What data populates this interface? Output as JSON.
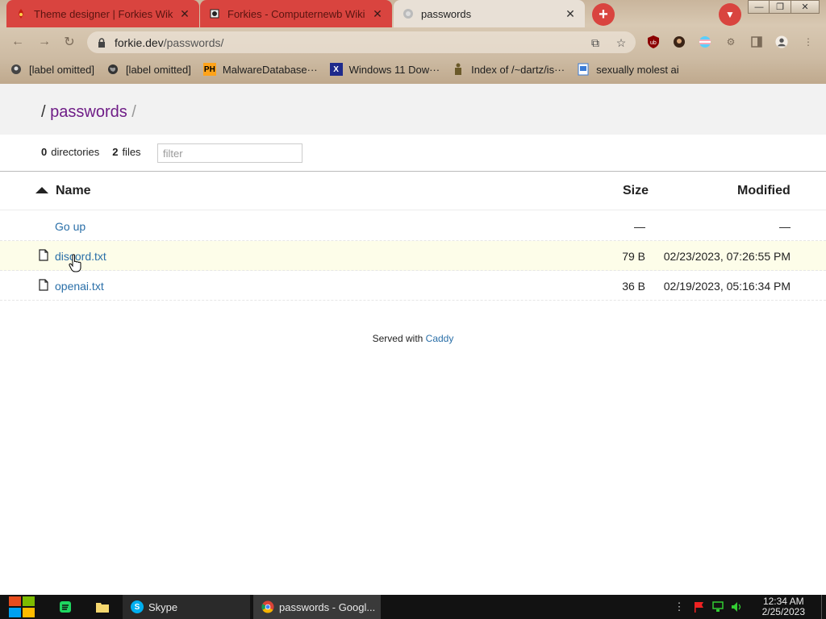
{
  "browser": {
    "tabs": [
      {
        "label": "Theme designer | Forkies Wiki",
        "active": false
      },
      {
        "label": "Forkies - Computernewb Wiki",
        "active": false
      },
      {
        "label": "passwords",
        "active": true
      }
    ],
    "new_tab": "+",
    "close_glyph": "✕",
    "url_host": "forkie.dev",
    "url_path": "/passwords/",
    "bookmarks": [
      {
        "label": "[label omitted]",
        "icon": "profile-icon"
      },
      {
        "label": "[label omitted]",
        "icon": "globe-icon"
      },
      {
        "label": "MalwareDatabase···",
        "icon": "ph-icon",
        "icon_text": "PH"
      },
      {
        "label": "Windows 11 Dow···",
        "icon": "x-icon",
        "icon_text": "X"
      },
      {
        "label": "Index of /~dartz/is···",
        "icon": "figure-icon"
      },
      {
        "label": "sexually molest ai",
        "icon": "page-icon"
      }
    ],
    "accent_color": "#d9443f"
  },
  "listing": {
    "breadcrumb_root": "/",
    "breadcrumb_dir": "passwords",
    "breadcrumb_sep": "/",
    "dir_count": "0",
    "dir_label": "directories",
    "file_count": "2",
    "file_label": "files",
    "filter_placeholder": "filter",
    "columns": {
      "name": "Name",
      "size": "Size",
      "modified": "Modified"
    },
    "go_up": {
      "label": "Go up",
      "size": "—",
      "modified": "—"
    },
    "files": [
      {
        "name": "discord.txt",
        "size": "79 B",
        "modified": "02/23/2023, 07:26:55 PM"
      },
      {
        "name": "openai.txt",
        "size": "36 B",
        "modified": "02/19/2023, 05:16:34 PM"
      }
    ],
    "footer_text": "Served with",
    "footer_link": "Caddy"
  },
  "taskbar": {
    "tasks": [
      {
        "label": "Skype"
      },
      {
        "label": "passwords - Googl..."
      }
    ],
    "time": "12:34 AM",
    "date": "2/25/2023"
  }
}
